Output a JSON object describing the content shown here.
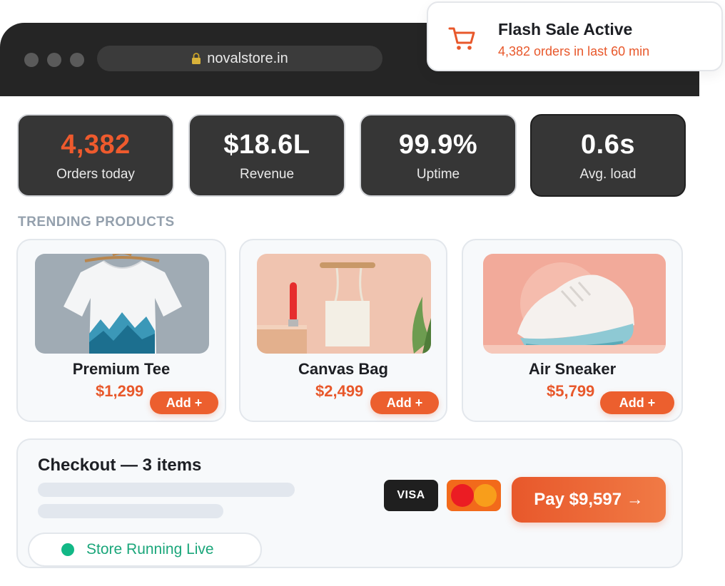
{
  "browser": {
    "url": "novalstore.in"
  },
  "toast": {
    "title": "Flash Sale Active",
    "subtitle": "4,382 orders in last 60 min",
    "icon": "shopping-cart-icon"
  },
  "stats": [
    {
      "value": "4,382",
      "label": "Orders today"
    },
    {
      "value": "$18.6L",
      "label": "Revenue"
    },
    {
      "value": "99.9%",
      "label": "Uptime"
    },
    {
      "value": "0.6s",
      "label": "Avg. load"
    }
  ],
  "trending": {
    "title": "TRENDING PRODUCTS",
    "products": [
      {
        "name": "Premium Tee",
        "price": "$1,299",
        "add_label": "Add +"
      },
      {
        "name": "Canvas Bag",
        "price": "$2,499",
        "add_label": "Add +"
      },
      {
        "name": "Air Sneaker",
        "price": "$5,799",
        "add_label": "Add +"
      }
    ]
  },
  "checkout": {
    "title": "Checkout — 3 items",
    "visa_label": "VISA",
    "pay_label": "Pay $9,597 →"
  },
  "status": {
    "label": "Store Running Live"
  },
  "colors": {
    "accent": "#e8582b",
    "dark_panel": "#363636",
    "live_green": "#12b886"
  }
}
